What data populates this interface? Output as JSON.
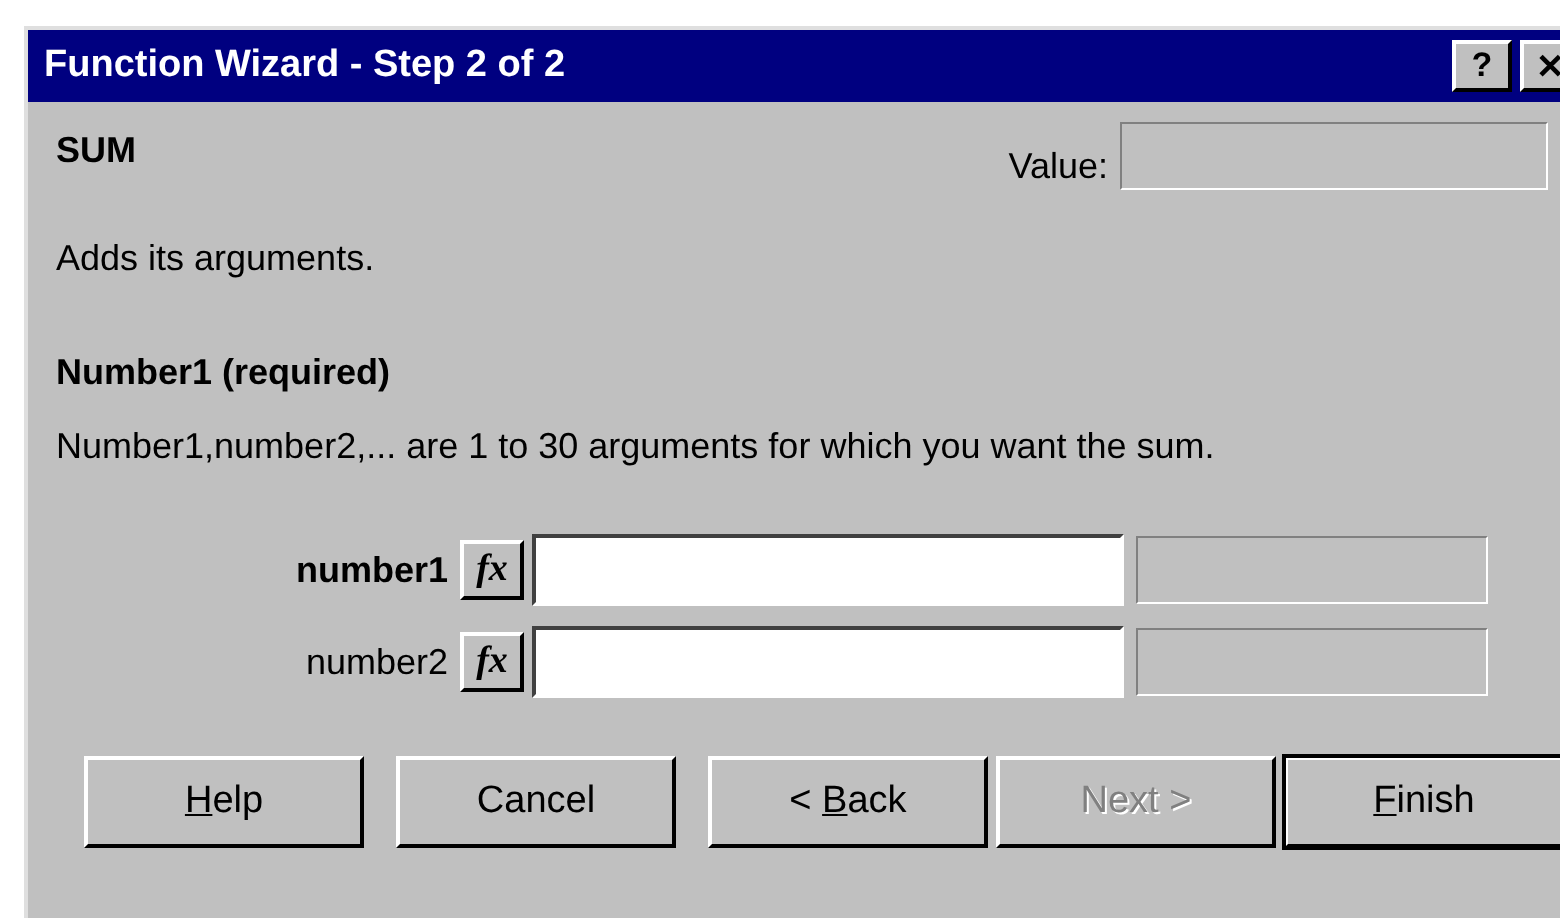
{
  "window": {
    "title": "Function Wizard - Step 2 of 2",
    "title_buttons": [
      "?",
      "✕"
    ]
  },
  "function": {
    "name": "SUM",
    "value_label": "Value:",
    "description": "Adds its arguments."
  },
  "argument_help": {
    "title": "Number1 (required)",
    "text": "Number1,number2,... are 1 to 30 arguments for which you want the sum."
  },
  "arguments": [
    {
      "label": "number1",
      "required": true,
      "fx": "fx"
    },
    {
      "label": "number2",
      "required": false,
      "fx": "fx"
    }
  ],
  "buttons": [
    {
      "key": "H",
      "post": "elp",
      "disabled": false,
      "default": false
    },
    {
      "post": "Cancel",
      "disabled": false,
      "default": false
    },
    {
      "pre": "< ",
      "key": "B",
      "post": "ack",
      "disabled": false,
      "default": false
    },
    {
      "post": "Next >",
      "disabled": true,
      "default": false
    },
    {
      "key": "F",
      "post": "inish",
      "disabled": false,
      "default": true
    }
  ]
}
